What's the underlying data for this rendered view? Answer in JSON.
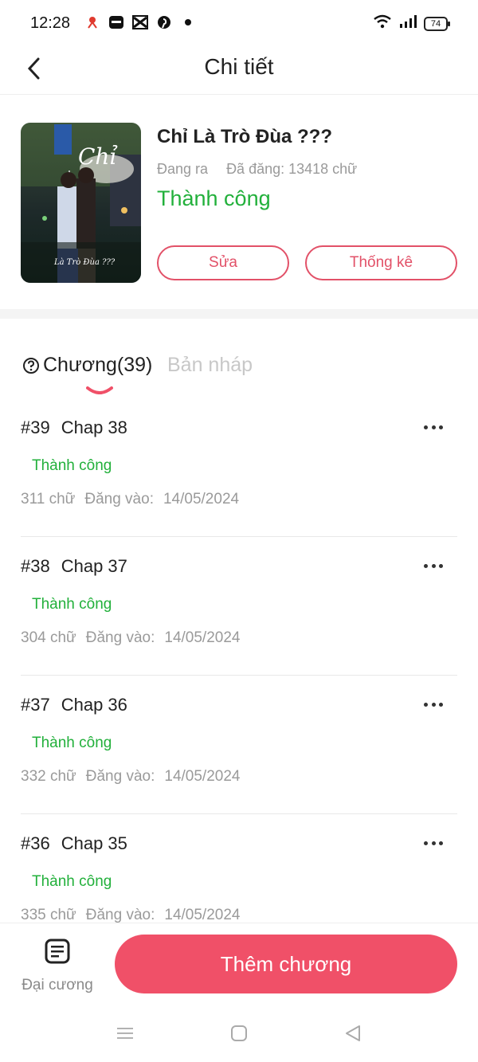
{
  "status_bar": {
    "time": "12:28",
    "battery": "74"
  },
  "header": {
    "title": "Chi tiết"
  },
  "story": {
    "title": "Chỉ Là Trò Đùa ???",
    "state": "Đang ra",
    "posted": "Đã đăng: 13418 chữ",
    "status": "Thành công",
    "edit_label": "Sửa",
    "stats_label": "Thống kê",
    "cover_text_top": "Chỉ",
    "cover_text_bottom": "Là Trò Đùa ???"
  },
  "tabs": {
    "chapters": "Chương(39)",
    "drafts": "Bản nháp"
  },
  "chapters": [
    {
      "num": "#39",
      "name": "Chap 38",
      "status": "Thành công",
      "words": "311 chữ",
      "date_label": "Đăng vào:",
      "date": "14/05/2024"
    },
    {
      "num": "#38",
      "name": "Chap 37",
      "status": "Thành công",
      "words": "304 chữ",
      "date_label": "Đăng vào:",
      "date": "14/05/2024"
    },
    {
      "num": "#37",
      "name": "Chap 36",
      "status": "Thành công",
      "words": "332 chữ",
      "date_label": "Đăng vào:",
      "date": "14/05/2024"
    },
    {
      "num": "#36",
      "name": "Chap 35",
      "status": "Thành công",
      "words": "335 chữ",
      "date_label": "Đăng vào:",
      "date": "14/05/2024"
    }
  ],
  "bottom": {
    "outline_label": "Đại cương",
    "add_label": "Thêm chương"
  },
  "colors": {
    "accent": "#f05068",
    "success": "#22b03b",
    "muted": "#9a9a9a"
  }
}
